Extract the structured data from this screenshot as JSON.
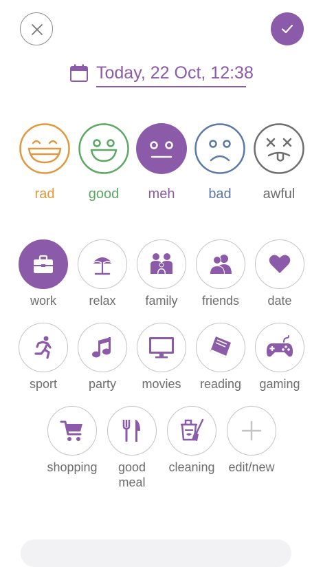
{
  "header": {
    "close_icon": "close-icon",
    "confirm_icon": "checkmark-icon"
  },
  "date": {
    "text": "Today, 22 Oct, 12:38",
    "icon": "calendar-icon"
  },
  "moods": [
    {
      "label": "rad",
      "color": "#e3973c"
    },
    {
      "label": "good",
      "color": "#5aa864"
    },
    {
      "label": "meh",
      "color": "#8b5aa8"
    },
    {
      "label": "bad",
      "color": "#5b78a8"
    },
    {
      "label": "awful",
      "color": "#6e6e6e"
    }
  ],
  "activities": [
    {
      "label": "work",
      "icon": "briefcase-icon",
      "selected": true
    },
    {
      "label": "relax",
      "icon": "beach-umbrella-icon"
    },
    {
      "label": "family",
      "icon": "family-icon"
    },
    {
      "label": "friends",
      "icon": "friends-icon"
    },
    {
      "label": "date",
      "icon": "heart-icon"
    },
    {
      "label": "sport",
      "icon": "running-icon"
    },
    {
      "label": "party",
      "icon": "music-note-icon"
    },
    {
      "label": "movies",
      "icon": "monitor-icon"
    },
    {
      "label": "reading",
      "icon": "book-icon"
    },
    {
      "label": "gaming",
      "icon": "gamepad-icon"
    },
    {
      "label": "shopping",
      "icon": "cart-icon"
    },
    {
      "label": "good meal",
      "icon": "cutlery-icon"
    },
    {
      "label": "cleaning",
      "icon": "cleaning-icon"
    },
    {
      "label": "edit/new",
      "icon": "plus-icon"
    }
  ],
  "colors": {
    "accent": "#8b5aa8",
    "icon_purple": "#8b5aa8",
    "border": "#c4c4c4",
    "label": "#6d6d6d"
  }
}
